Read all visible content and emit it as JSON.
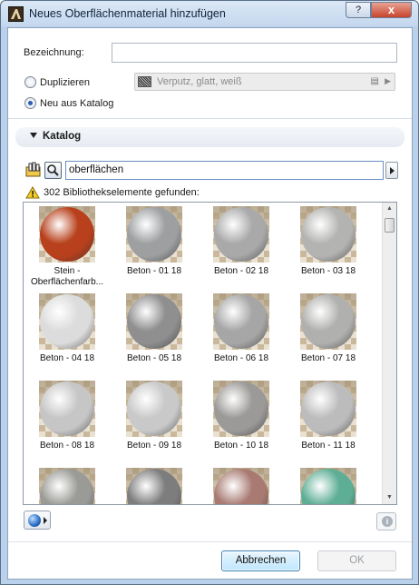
{
  "window": {
    "title": "Neues Oberflächenmaterial hinzufügen",
    "help_label": "?",
    "close_label": "x"
  },
  "form": {
    "name_label": "Bezeichnung:",
    "name_value": "",
    "duplicate_label": "Duplizieren",
    "duplicate_value": "Verputz, glatt, weiß",
    "new_from_catalog_label": "Neu aus Katalog",
    "selected_option": "new_from_catalog"
  },
  "catalog": {
    "section_title": "Katalog",
    "search_value": "oberflächen",
    "result_text": "302 Bibliothekselemente gefunden:",
    "items": [
      {
        "label": "Stein - Oberflächenfarb...",
        "color": "#b8401c"
      },
      {
        "label": "Beton - 01 18",
        "color": "#9d9fa1"
      },
      {
        "label": "Beton - 02 18",
        "color": "#a9a9a9"
      },
      {
        "label": "Beton - 03 18",
        "color": "#b3b3b1"
      },
      {
        "label": "Beton - 04 18",
        "color": "#dcdcdc"
      },
      {
        "label": "Beton - 05 18",
        "color": "#8f8f8f"
      },
      {
        "label": "Beton - 06 18",
        "color": "#a6a6a6"
      },
      {
        "label": "Beton - 07 18",
        "color": "#b0b0ae"
      },
      {
        "label": "Beton - 08 18",
        "color": "#c6c6c6"
      },
      {
        "label": "Beton - 09 18",
        "color": "#c9c9c9"
      },
      {
        "label": "Beton - 10 18",
        "color": "#9c9a98"
      },
      {
        "label": "Beton - 11 18",
        "color": "#bcbcbc"
      },
      {
        "label": "",
        "color": "#9a9a96"
      },
      {
        "label": "",
        "color": "#7c7d7c"
      },
      {
        "label": "",
        "color": "#a87a72"
      },
      {
        "label": "",
        "color": "#5eae95"
      }
    ]
  },
  "buttons": {
    "cancel_label": "Abbrechen",
    "ok_label": "OK"
  },
  "icons": {
    "app": "archicad-icon",
    "library": "library-folder-icon",
    "search": "search-icon",
    "warning": "warning-icon",
    "globe": "globe-icon",
    "info": "info-icon",
    "info_glyph": "i"
  }
}
